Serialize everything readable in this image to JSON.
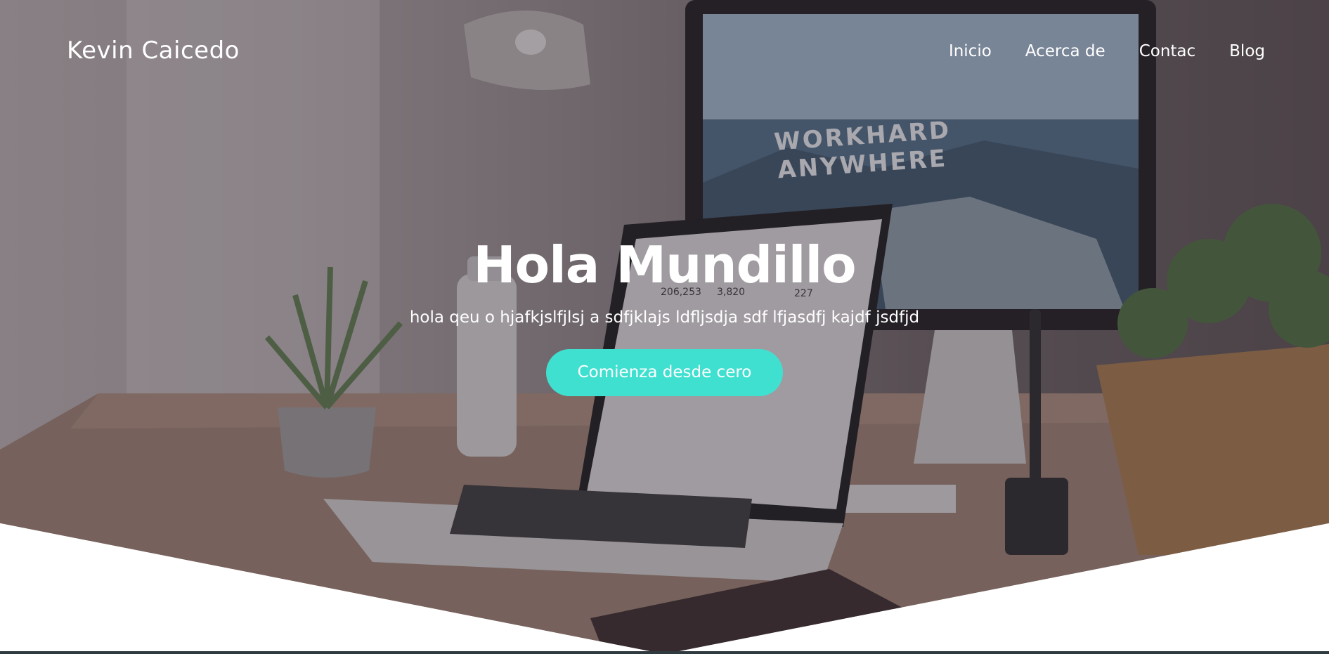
{
  "brand": {
    "name": "Kevin Caicedo"
  },
  "nav": {
    "items": [
      "Inicio",
      "Acerca de",
      "Contac",
      "Blog"
    ]
  },
  "hero": {
    "title": "Hola Mundillo",
    "subtitle": "hola qeu o hjafkjslfjlsj a sdfjklajs ldfljsdja sdf lfjasdfj kajdf jsdfjd",
    "cta_label": "Comienza desde cero"
  },
  "background_photo": {
    "monitor_text_line1": "WORKHARD",
    "monitor_text_line2": "ANYWHERE",
    "laptop_stats": [
      "206,253",
      "3,820",
      "227"
    ]
  },
  "colors": {
    "accent": "#40e0d0",
    "text": "#ffffff"
  }
}
